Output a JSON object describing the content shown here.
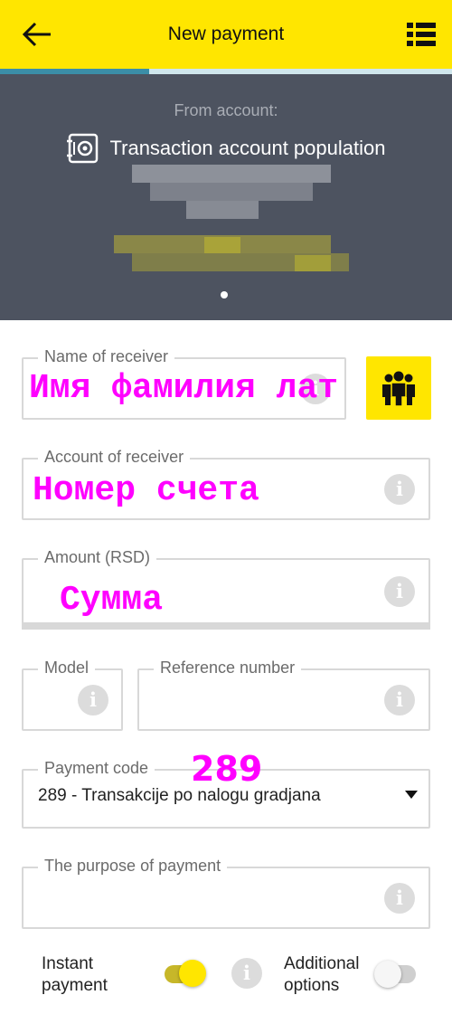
{
  "header": {
    "title": "New payment",
    "progress_fraction": 0.33,
    "accent": "#ffe600"
  },
  "account": {
    "from_label": "From account:",
    "name": "Transaction account population",
    "icon": "safe-icon"
  },
  "form": {
    "receiver_name": {
      "label": "Name of receiver",
      "value": "Имя фамилия лат"
    },
    "receiver_account": {
      "label": "Account of receiver",
      "value": "Номер счета"
    },
    "amount": {
      "label": "Amount (RSD)",
      "value": "Сумма"
    },
    "model": {
      "label": "Model"
    },
    "reference": {
      "label": "Reference number"
    },
    "payment_code": {
      "label": "Payment code",
      "annotation": "289",
      "value": "289 - Transakcije po nalogu gradjana"
    },
    "purpose": {
      "label": "The purpose of payment"
    },
    "info_glyph": "i"
  },
  "options": {
    "instant_payment": {
      "label_line1": "Instant",
      "label_line2": "payment",
      "on": true
    },
    "additional_options": {
      "label_line1": "Additional",
      "label_line2": "options",
      "on": false
    }
  }
}
